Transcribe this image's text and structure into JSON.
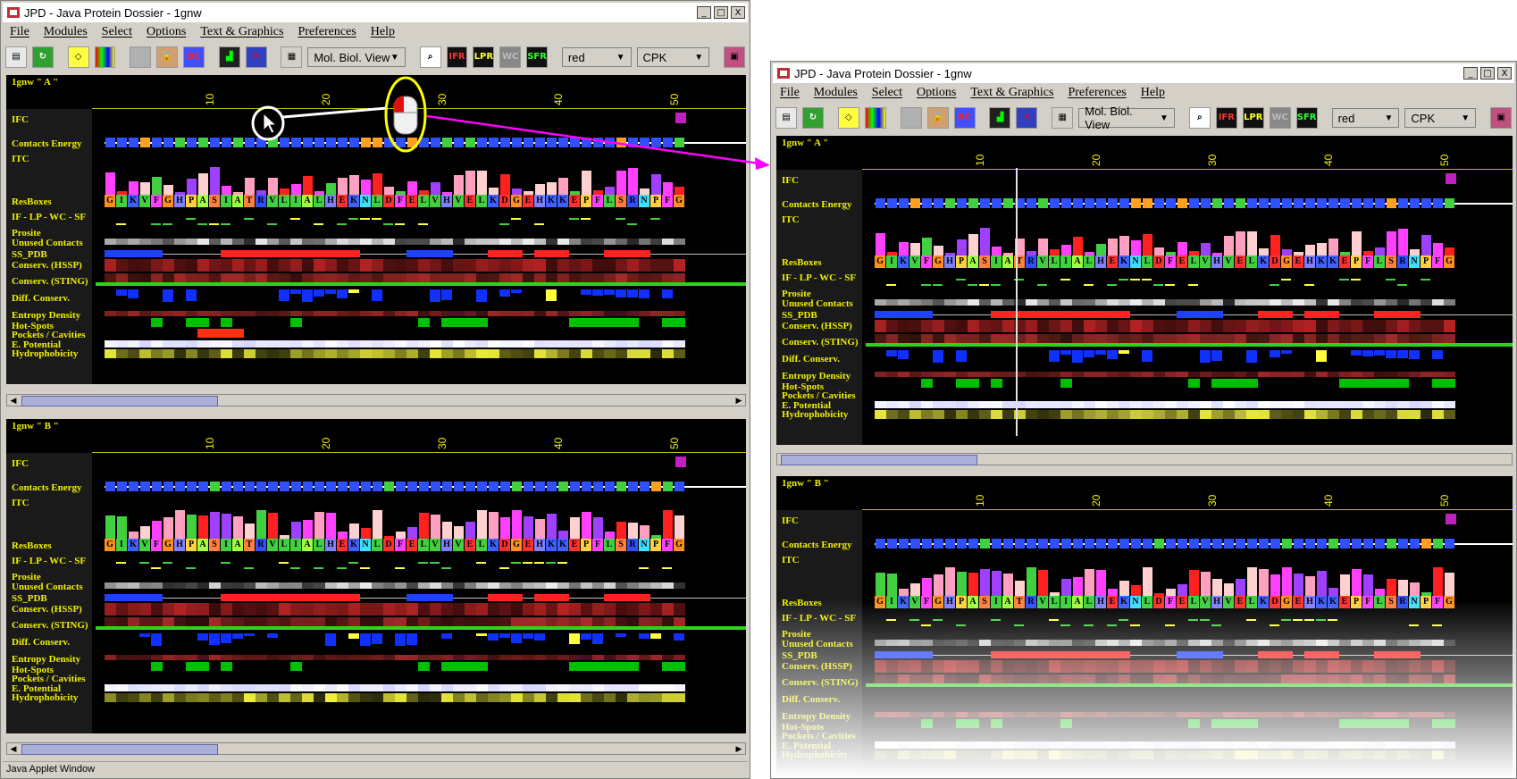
{
  "window": {
    "title": "JPD - Java Protein Dossier - 1gnw",
    "status": "Java Applet Window",
    "controls": [
      "_",
      "□",
      "X"
    ]
  },
  "menu": [
    "File",
    "Modules",
    "Select",
    "Options",
    "Text & Graphics",
    "Preferences",
    "Help"
  ],
  "toolbar": {
    "view_combo": "Mol. Biol. View",
    "color_combo": "red",
    "scheme_combo": "CPK",
    "icons": [
      "printer-icon",
      "refresh-icon",
      "eraser-icon",
      "grid-color-icon",
      "doc-icon",
      "lock-icon",
      "bc-icon",
      "chart-icon",
      "chart-x-icon",
      "layout-icon",
      "magnifier-icon",
      "ifr-icon",
      "lpr-icon",
      "wc-icon",
      "sfr-icon",
      "book-icon"
    ],
    "icon_labels": {
      "bc": "BC",
      "ifr": "IFR",
      "lpr": "LPR",
      "wc": "WC",
      "sfr": "SFR"
    }
  },
  "chains": [
    {
      "name": "1gnw \" A \""
    },
    {
      "name": "1gnw \" B \""
    }
  ],
  "ticks": [
    "10",
    "20",
    "30",
    "40",
    "50"
  ],
  "tracks": [
    "IFC",
    "Contacts Energy",
    "ITC",
    "ResBoxes",
    "IF - LP - WC - SF",
    "Prosite",
    "Unused Contacts",
    "SS_PDB",
    "Conserv. (HSSP)",
    "Conserv. (STING)",
    "Diff. Conserv.",
    "Entropy Density",
    "Hot-Spots",
    "Pockets / Cavities",
    "E. Potential",
    "Hydrophobicity"
  ],
  "sequence": [
    "G",
    "I",
    "K",
    "V",
    "F",
    "G",
    "H",
    "P",
    "A",
    "S",
    "I",
    "A",
    "T",
    "R",
    "V",
    "L",
    "I",
    "A",
    "L",
    "H",
    "E",
    "K",
    "N",
    "L",
    "D",
    "F",
    "E",
    "L",
    "V",
    "H",
    "V",
    "E",
    "L",
    "K",
    "D",
    "G",
    "E",
    "H",
    "K",
    "K",
    "E",
    "P",
    "F",
    "L",
    "S",
    "R",
    "N",
    "P",
    "F",
    "G"
  ],
  "colors": {
    "label_yellow": "#f0f000",
    "bg": "#000000",
    "label_bg": "#1a1a1a",
    "helix_red": "#ff2020",
    "strand_blue": "#2040ff",
    "hotspot_green": "#00c000",
    "callout_white": "#ffffff",
    "callout_yellow": "#ffff00",
    "arrow_magenta": "#ff00ff"
  }
}
